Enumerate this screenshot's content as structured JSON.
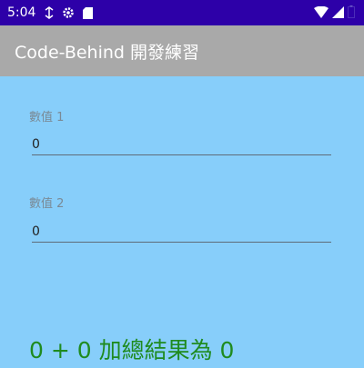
{
  "status_bar": {
    "time": "5:04",
    "icons": [
      "nfc-icon",
      "settings-icon",
      "sim-card-icon",
      "wifi-icon",
      "signal-icon",
      "battery-icon"
    ]
  },
  "app_bar": {
    "title": "Code-Behind 開發練習"
  },
  "form": {
    "field1": {
      "label": "數值 1",
      "value": "0"
    },
    "field2": {
      "label": "數值 2",
      "value": "0"
    }
  },
  "result": {
    "text": "0 + 0 加總結果為 0"
  },
  "colors": {
    "status_bar": "#2d00a8",
    "app_bar": "#a9a9a9",
    "background": "#87cefa",
    "result_text": "#1f8b1f"
  }
}
